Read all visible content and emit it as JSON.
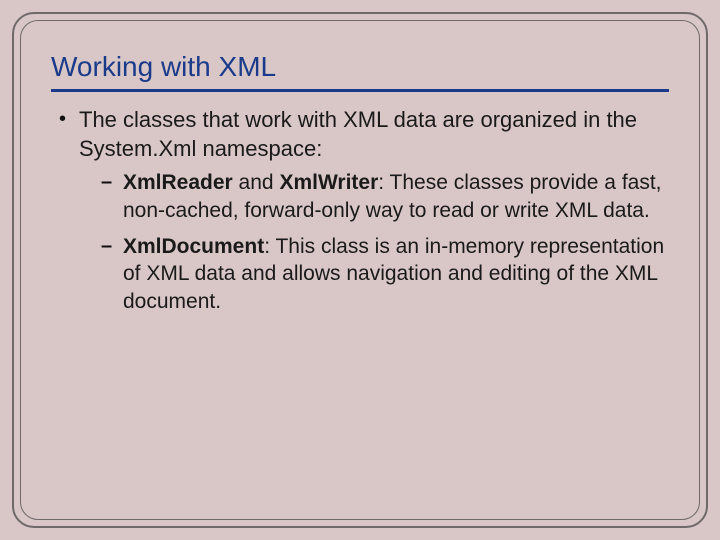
{
  "title": "Working with XML",
  "bullets": [
    {
      "text": "The classes that work with XML data are organized in the System.Xml namespace:",
      "sub": [
        {
          "bold1": "XmlReader",
          "mid": " and ",
          "bold2": "XmlWriter",
          "rest": ": These classes provide a fast, non-cached, forward-only way to read or write XML data."
        },
        {
          "bold1": "XmlDocument",
          "rest": ": This class is an in-memory representation of XML data and allows navigation and editing of the XML document."
        }
      ]
    }
  ]
}
